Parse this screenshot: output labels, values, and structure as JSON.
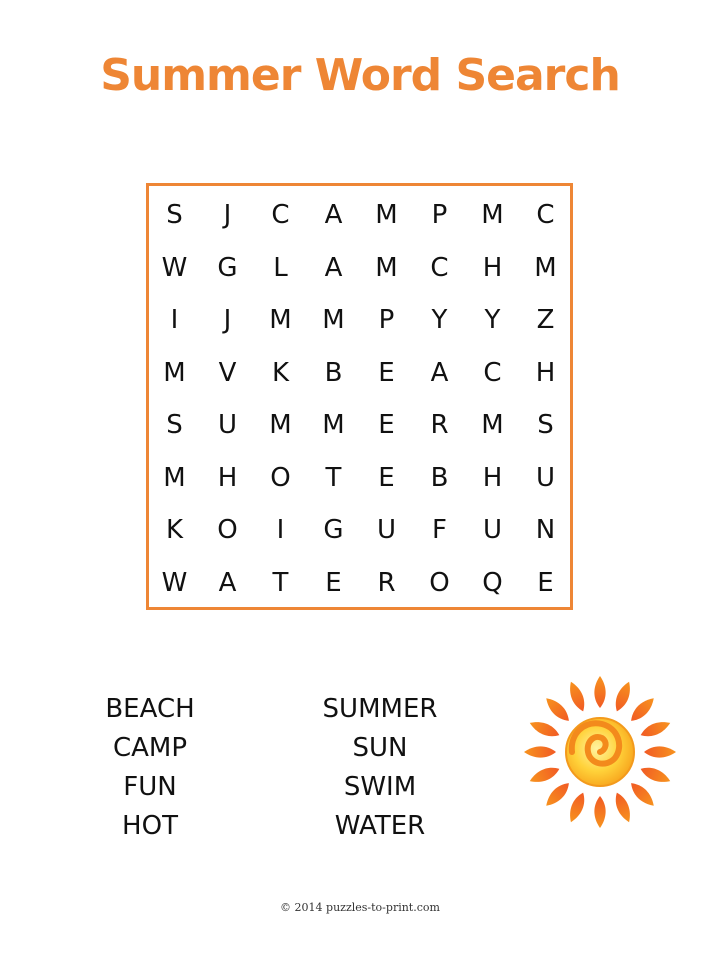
{
  "title": "Summer Word Search",
  "colors": {
    "accent": "#ee8635",
    "text": "#111111"
  },
  "grid": [
    [
      "S",
      "J",
      "C",
      "A",
      "M",
      "P",
      "M",
      "C"
    ],
    [
      "W",
      "G",
      "L",
      "A",
      "M",
      "C",
      "H",
      "M"
    ],
    [
      "I",
      "J",
      "M",
      "M",
      "P",
      "Y",
      "Y",
      "Z"
    ],
    [
      "M",
      "V",
      "K",
      "B",
      "E",
      "A",
      "C",
      "H"
    ],
    [
      "S",
      "U",
      "M",
      "M",
      "E",
      "R",
      "M",
      "S"
    ],
    [
      "M",
      "H",
      "O",
      "T",
      "E",
      "B",
      "H",
      "U"
    ],
    [
      "K",
      "O",
      "I",
      "G",
      "U",
      "F",
      "U",
      "N"
    ],
    [
      "W",
      "A",
      "T",
      "E",
      "R",
      "O",
      "Q",
      "E"
    ]
  ],
  "word_list": {
    "column1": [
      "BEACH",
      "CAMP",
      "FUN",
      "HOT"
    ],
    "column2": [
      "SUMMER",
      "SUN",
      "SWIM",
      "WATER"
    ]
  },
  "illustration": "sun-icon",
  "footer": "© 2014 puzzles-to-print.com"
}
